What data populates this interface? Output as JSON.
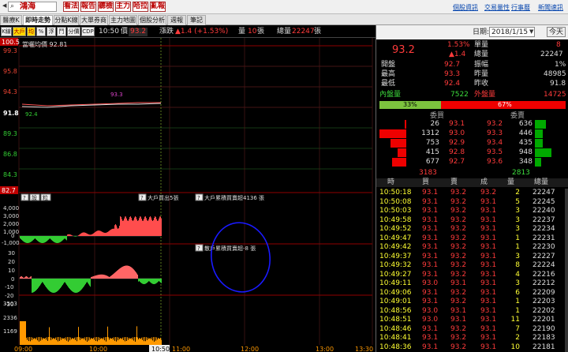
{
  "topbar": {
    "stock_name": "鴻海",
    "buttons": [
      "看法",
      "報告",
      "聽檢",
      "主力",
      "哈拉",
      "亂報"
    ],
    "links": [
      "個股資訊",
      "交易量性",
      "行事曆",
      "新聞速訊"
    ]
  },
  "tabs": [
    "醫療K線",
    "即時走勢",
    "分點K線",
    "大單券商",
    "主力地圖",
    "個股分析",
    "週報",
    "筆記"
  ],
  "active_tab": "即時走勢",
  "toolbar": {
    "buttons": [
      "K線",
      "大戶",
      "均",
      "%",
      "浮",
      "鬥",
      "分價",
      "CDP"
    ],
    "time": "10:50",
    "price_label": "價",
    "price": "93.2",
    "change_label": "漲跌",
    "change": "▲1.4 (+1.53%)",
    "vol_label": "量",
    "vol": "10",
    "vol_unit": "張",
    "total_label": "總量",
    "total": "22247",
    "total_unit": "張"
  },
  "chart": {
    "ma_label": "當曬均價 92.81",
    "y_price": [
      "100.5",
      "99.3",
      "95.8",
      "94.3",
      "91.8",
      "89.3",
      "86.8",
      "84.3",
      "82.7"
    ],
    "price_peak_label": "93.3",
    "price_low_label": "92.4",
    "p2_buttons": [
      "?",
      "設",
      "粒"
    ],
    "p2_label1": "大戶買出5張",
    "p2_label2": "大戶累積買賣超4136 張",
    "p2_ticks": [
      "4,000",
      "3,000",
      "2,000",
      "1,000",
      "0",
      "-1,000"
    ],
    "p3_label": "散戶累積買賣超-8 張",
    "p3_ticks": [
      "30",
      "20",
      "10",
      "0",
      "-10",
      "-20",
      "-30"
    ],
    "p4_ticks": [
      "3503",
      "2336",
      "1169"
    ],
    "x_ticks": [
      "09:00",
      "10:00",
      "11:00",
      "12:00",
      "13:00",
      "13:30"
    ],
    "cursor_time": "10:50"
  },
  "right": {
    "date_label": "日期:",
    "date": "2018/1/15",
    "today_btn": "今天",
    "quote": {
      "price": "93.2",
      "pct": "1.53%",
      "chg": "▲1.4",
      "unit_label": "單量",
      "unit": "8",
      "total_label": "總量",
      "total": "22247",
      "rows": [
        {
          "l": "開盤",
          "v": "92.7",
          "l2": "振幅",
          "v2": "1%"
        },
        {
          "l": "最高",
          "v": "93.3",
          "l2": "昨量",
          "v2": "48985"
        },
        {
          "l": "最低",
          "v": "92.4",
          "l2": "昨收",
          "v2": "91.8"
        }
      ],
      "inner_label": "內盤量",
      "inner": "7522",
      "outer_label": "外盤量",
      "outer": "14725",
      "inner_pct": "33%",
      "outer_pct": "67%",
      "inner_frac": 0.33
    },
    "book": {
      "bid_label": "委買",
      "ask_label": "委賣",
      "rows": [
        {
          "bq": "26",
          "bp": "93.1",
          "ap": "93.2",
          "aq": "636"
        },
        {
          "bq": "1312",
          "bp": "93.0",
          "ap": "93.3",
          "aq": "446"
        },
        {
          "bq": "753",
          "bp": "92.9",
          "ap": "93.4",
          "aq": "435"
        },
        {
          "bq": "415",
          "bp": "92.8",
          "ap": "93.5",
          "aq": "948"
        },
        {
          "bq": "677",
          "bp": "92.7",
          "ap": "93.6",
          "aq": "348"
        }
      ],
      "bid_total": "3183",
      "ask_total": "2813"
    },
    "ticks_header": [
      "時",
      "買",
      "賣",
      "成",
      "量",
      "總量"
    ],
    "ticks": [
      {
        "t": "10:50:18",
        "b": "93.1",
        "a": "93.2",
        "p": "93.2",
        "q": "2",
        "tot": "22247"
      },
      {
        "t": "10:50:08",
        "b": "93.1",
        "a": "93.2",
        "p": "93.1",
        "q": "5",
        "tot": "22245"
      },
      {
        "t": "10:50:03",
        "b": "93.1",
        "a": "93.2",
        "p": "93.1",
        "q": "3",
        "tot": "22240"
      },
      {
        "t": "10:49:58",
        "b": "93.1",
        "a": "93.2",
        "p": "93.1",
        "q": "3",
        "tot": "22237"
      },
      {
        "t": "10:49:52",
        "b": "93.1",
        "a": "93.2",
        "p": "93.1",
        "q": "3",
        "tot": "22234"
      },
      {
        "t": "10:49:47",
        "b": "93.1",
        "a": "93.2",
        "p": "93.1",
        "q": "1",
        "tot": "22231"
      },
      {
        "t": "10:49:42",
        "b": "93.1",
        "a": "93.2",
        "p": "93.1",
        "q": "1",
        "tot": "22230"
      },
      {
        "t": "10:49:37",
        "b": "93.1",
        "a": "93.2",
        "p": "93.1",
        "q": "3",
        "tot": "22227"
      },
      {
        "t": "10:49:32",
        "b": "93.1",
        "a": "93.2",
        "p": "93.1",
        "q": "8",
        "tot": "22224"
      },
      {
        "t": "10:49:27",
        "b": "93.1",
        "a": "93.2",
        "p": "93.1",
        "q": "4",
        "tot": "22216"
      },
      {
        "t": "10:49:11",
        "b": "93.0",
        "a": "93.1",
        "p": "93.1",
        "q": "3",
        "tot": "22212"
      },
      {
        "t": "10:49:06",
        "b": "93.1",
        "a": "93.2",
        "p": "93.1",
        "q": "6",
        "tot": "22209"
      },
      {
        "t": "10:49:01",
        "b": "93.1",
        "a": "93.2",
        "p": "93.1",
        "q": "1",
        "tot": "22203"
      },
      {
        "t": "10:48:56",
        "b": "93.0",
        "a": "93.1",
        "p": "93.1",
        "q": "1",
        "tot": "22202"
      },
      {
        "t": "10:48:51",
        "b": "93.0",
        "a": "93.1",
        "p": "93.1",
        "q": "11",
        "tot": "22201"
      },
      {
        "t": "10:48:46",
        "b": "93.1",
        "a": "93.2",
        "p": "93.1",
        "q": "7",
        "tot": "22190"
      },
      {
        "t": "10:48:41",
        "b": "93.1",
        "a": "93.2",
        "p": "93.1",
        "q": "2",
        "tot": "22183"
      },
      {
        "t": "10:48:36",
        "b": "93.1",
        "a": "93.2",
        "p": "93.1",
        "q": "10",
        "tot": "22181"
      }
    ]
  },
  "colors": {
    "up": "#ff3b3b",
    "down": "#3ddc3d",
    "even": "#ffff33",
    "axis_red": "#c00000"
  }
}
